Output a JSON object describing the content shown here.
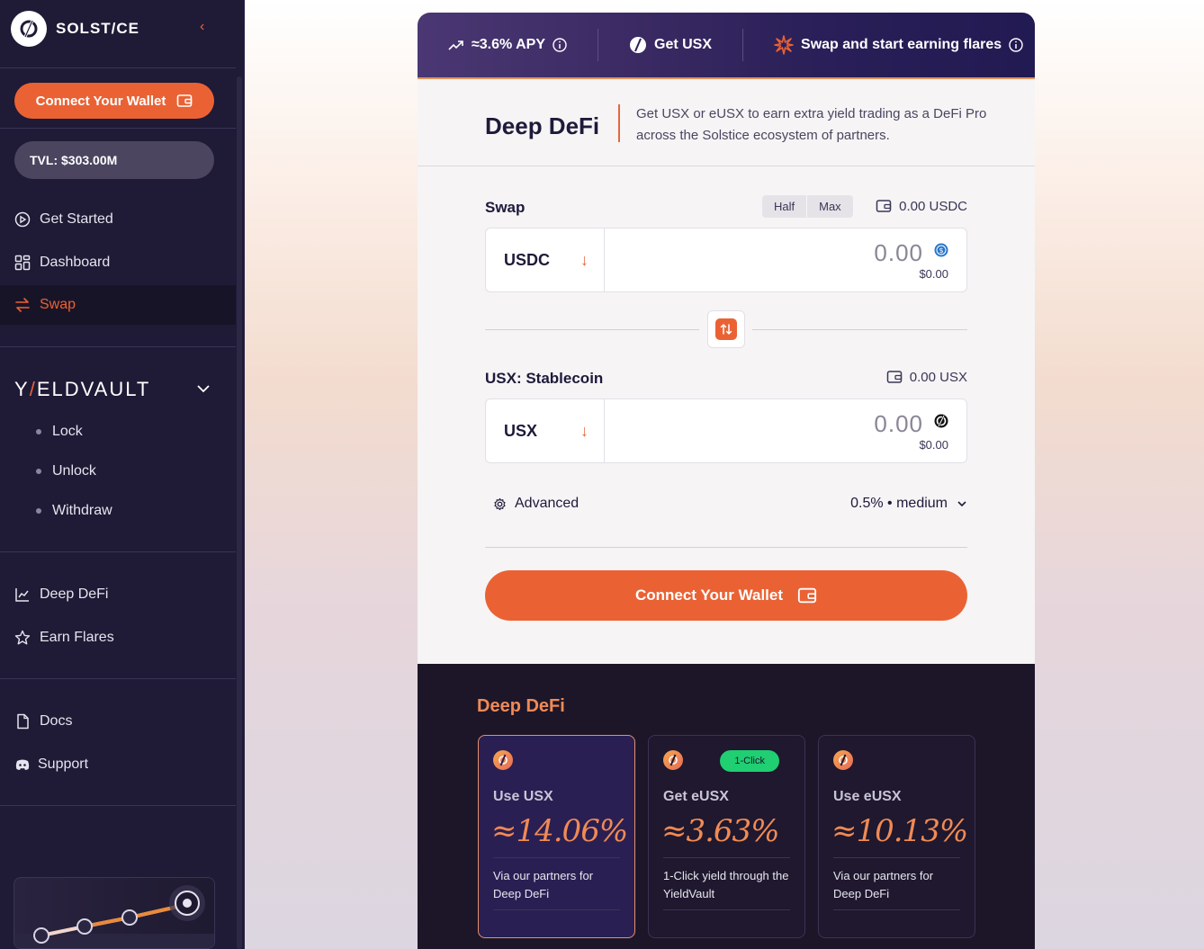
{
  "sidebar": {
    "brand": "SOLST/CE",
    "connect_wallet": "Connect Your Wallet",
    "tvl": "TVL: $303.00M",
    "nav": [
      {
        "label": "Get Started",
        "icon": "play-circle-icon"
      },
      {
        "label": "Dashboard",
        "icon": "grid-icon"
      },
      {
        "label": "Swap",
        "icon": "swap-arrows-icon",
        "active": true
      }
    ],
    "yieldvault": {
      "title_left": "Y",
      "title_slash": "/",
      "title_right": "ELDVAULT",
      "items": [
        "Lock",
        "Unlock",
        "Withdraw"
      ]
    },
    "nav2": [
      {
        "label": "Deep DeFi",
        "icon": "chart-icon"
      },
      {
        "label": "Earn Flares",
        "icon": "star-icon"
      }
    ],
    "nav3": [
      {
        "label": "Docs",
        "icon": "document-icon"
      },
      {
        "label": "Support",
        "icon": "discord-icon"
      }
    ]
  },
  "topbar": {
    "apy": "≈3.6% APY",
    "get_usx": "Get USX",
    "swap_earn": "Swap and start earning flares"
  },
  "hero": {
    "title": "Deep DeFi",
    "text": "Get USX or eUSX to earn extra yield trading as a DeFi Pro across the Solstice ecosystem of partners."
  },
  "swap": {
    "label": "Swap",
    "half": "Half",
    "max": "Max",
    "balance": "0.00 USDC",
    "from": {
      "token": "USDC",
      "amount": "0.00",
      "usd": "$0.00"
    },
    "to_label": "USX: Stablecoin",
    "to_balance": "0.00 USX",
    "to": {
      "token": "USX",
      "amount": "0.00",
      "usd": "$0.00"
    },
    "advanced": "Advanced",
    "slippage": "0.5% • medium",
    "connect_wallet": "Connect Your Wallet"
  },
  "deepdefi": {
    "title": "Deep DeFi",
    "cards": [
      {
        "name": "Use USX",
        "apy": "≈14.06%",
        "desc": "Via our partners for Deep DeFi",
        "badge": ""
      },
      {
        "name": "Get eUSX",
        "apy": "≈3.63%",
        "desc": "1-Click yield through the YieldVault",
        "badge": "1-Click"
      },
      {
        "name": "Use eUSX",
        "apy": "≈10.13%",
        "desc": "Via our partners for Deep DeFi",
        "badge": ""
      }
    ]
  },
  "colors": {
    "accent": "#ea6234",
    "sidebar": "#1f1a36",
    "badge": "#1fcf72"
  }
}
